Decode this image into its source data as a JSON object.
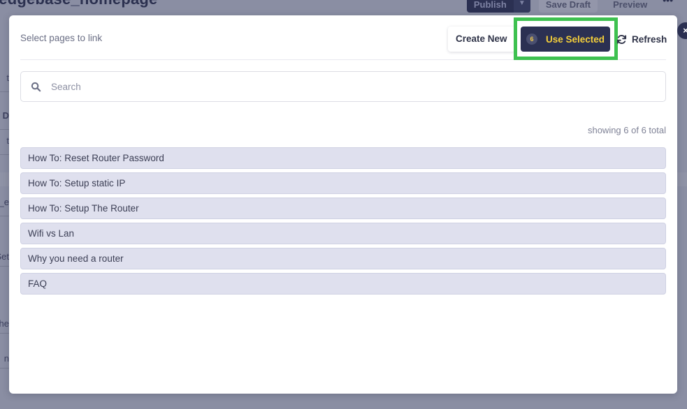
{
  "background_page": {
    "title": "ledgebase_homepage",
    "publish_label": "Publish",
    "save_draft_label": "Save Draft",
    "preview_label": "Preview",
    "more_label": "•••",
    "sidebar_fragments": [
      "t",
      "D",
      "t",
      "e_",
      "Set",
      "he",
      "n"
    ]
  },
  "modal": {
    "title": "Select pages to link",
    "create_new_label": "Create New",
    "use_selected": {
      "count": "6",
      "label": "Use Selected"
    },
    "refresh_label": "Refresh",
    "close_icon": "×",
    "search": {
      "placeholder": "Search",
      "value": ""
    },
    "showing_text": "showing 6 of 6 total",
    "pages": [
      "How To: Reset Router Password",
      "How To: Setup static IP",
      "How To: Setup The Router",
      "Wifi vs Lan",
      "Why you need a router",
      "FAQ"
    ]
  },
  "colors": {
    "accent_dark": "#2b3052",
    "accent_yellow": "#f5cf3a",
    "highlight_green": "#3ec150",
    "list_item_bg": "#dfe0ee"
  }
}
